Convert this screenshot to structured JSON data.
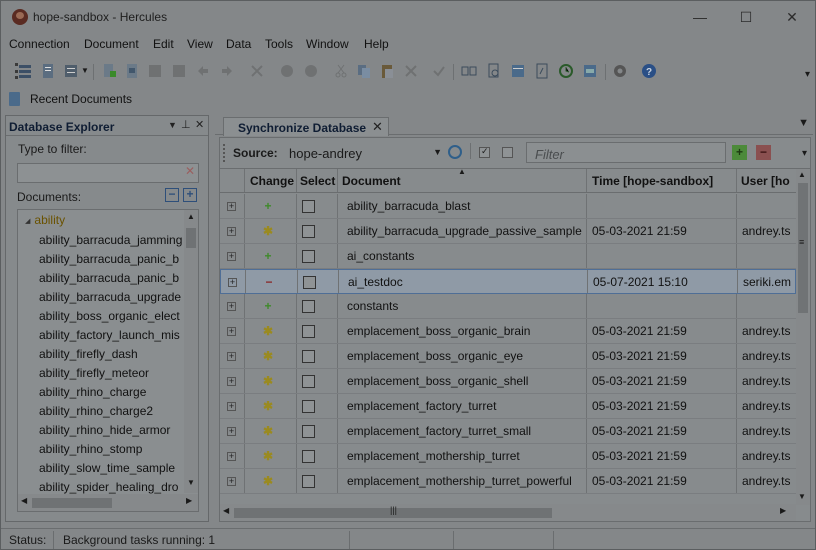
{
  "window": {
    "title": "hope-sandbox - Hercules",
    "minimize": "—",
    "maximize": "☐",
    "close": "✕"
  },
  "menu": [
    "Connection",
    "Document",
    "Edit",
    "View",
    "Data",
    "Tools",
    "Window",
    "Help"
  ],
  "recent": {
    "label": "Recent Documents"
  },
  "explorer": {
    "title": "Database Explorer",
    "filter_label": "Type to filter:",
    "filter_value": "",
    "documents_label": "Documents:",
    "root": "ability",
    "items": [
      "ability_barracuda_jamming",
      "ability_barracuda_panic_b",
      "ability_barracuda_panic_b",
      "ability_barracuda_upgrade",
      "ability_boss_organic_elect",
      "ability_factory_launch_mis",
      "ability_firefly_dash",
      "ability_firefly_meteor",
      "ability_rhino_charge",
      "ability_rhino_charge2",
      "ability_rhino_hide_armor",
      "ability_rhino_stomp",
      "ability_slow_time_sample",
      "ability_spider_healing_dro"
    ]
  },
  "sync": {
    "tab_title": "Synchronize Database",
    "source_label": "Source:",
    "source_value": "hope-andrey",
    "filter_placeholder": "Filter",
    "columns": [
      "Change",
      "Select",
      "Document",
      "Time [hope-sandbox]",
      "User [ho"
    ],
    "rows": [
      {
        "change": "add",
        "document": "ability_barracuda_blast",
        "time": "",
        "user": ""
      },
      {
        "change": "mod",
        "document": "ability_barracuda_upgrade_passive_sample",
        "time": "05-03-2021 21:59",
        "user": "andrey.ts"
      },
      {
        "change": "add",
        "document": "ai_constants",
        "time": "",
        "user": ""
      },
      {
        "change": "del",
        "document": "ai_testdoc",
        "time": "05-07-2021 15:10",
        "user": "seriki.em",
        "selected": true
      },
      {
        "change": "add",
        "document": "constants",
        "time": "",
        "user": ""
      },
      {
        "change": "mod",
        "document": "emplacement_boss_organic_brain",
        "time": "05-03-2021 21:59",
        "user": "andrey.ts"
      },
      {
        "change": "mod",
        "document": "emplacement_boss_organic_eye",
        "time": "05-03-2021 21:59",
        "user": "andrey.ts"
      },
      {
        "change": "mod",
        "document": "emplacement_boss_organic_shell",
        "time": "05-03-2021 21:59",
        "user": "andrey.ts"
      },
      {
        "change": "mod",
        "document": "emplacement_factory_turret",
        "time": "05-03-2021 21:59",
        "user": "andrey.ts"
      },
      {
        "change": "mod",
        "document": "emplacement_factory_turret_small",
        "time": "05-03-2021 21:59",
        "user": "andrey.ts"
      },
      {
        "change": "mod",
        "document": "emplacement_mothership_turret",
        "time": "05-03-2021 21:59",
        "user": "andrey.ts"
      },
      {
        "change": "mod",
        "document": "emplacement_mothership_turret_powerful",
        "time": "05-03-2021 21:59",
        "user": "andrey.ts"
      }
    ]
  },
  "status": {
    "label": "Status:",
    "text": "Background tasks running: 1"
  },
  "colors": {
    "add": "#3f8a2a",
    "mod": "#9a8a20",
    "del": "#8a2a2a",
    "selected_row": "#8f9aa6"
  }
}
